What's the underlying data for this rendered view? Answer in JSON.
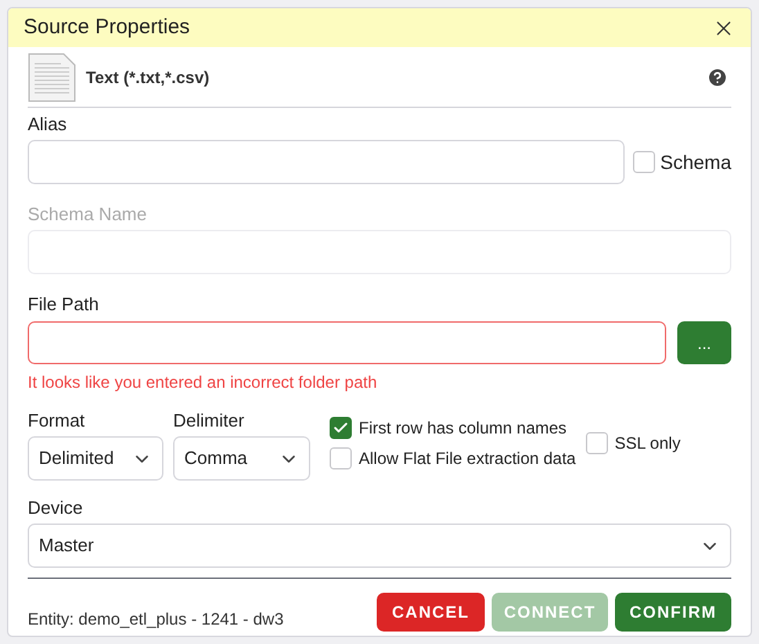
{
  "dialog": {
    "title": "Source Properties"
  },
  "source": {
    "name": "Text (*.txt,*.csv)"
  },
  "alias": {
    "label": "Alias"
  },
  "schema_toggle": {
    "label": "Schema",
    "checked": false
  },
  "schema_name": {
    "label": "Schema Name",
    "disabled": true
  },
  "file_path": {
    "label": "File Path",
    "invalid": true,
    "error": "It looks like you entered an incorrect folder path",
    "browse": "..."
  },
  "format": {
    "label": "Format",
    "value": "Delimited"
  },
  "delimiter": {
    "label": "Delimiter",
    "value": "Comma"
  },
  "options": [
    {
      "label": "First row has column names",
      "checked": true
    },
    {
      "label": "Allow Flat File extraction data",
      "checked": false
    }
  ],
  "ssl": {
    "label": "SSL only",
    "checked": false
  },
  "device": {
    "label": "Device",
    "value": "Master"
  },
  "entity": "Entity: demo_etl_plus - 1241 - dw3",
  "buttons": [
    {
      "label": "CANCEL",
      "kind": "danger",
      "disabled": false
    },
    {
      "label": "CONNECT",
      "kind": "primary",
      "disabled": true
    },
    {
      "label": "CONFIRM",
      "kind": "primary",
      "disabled": false
    }
  ]
}
